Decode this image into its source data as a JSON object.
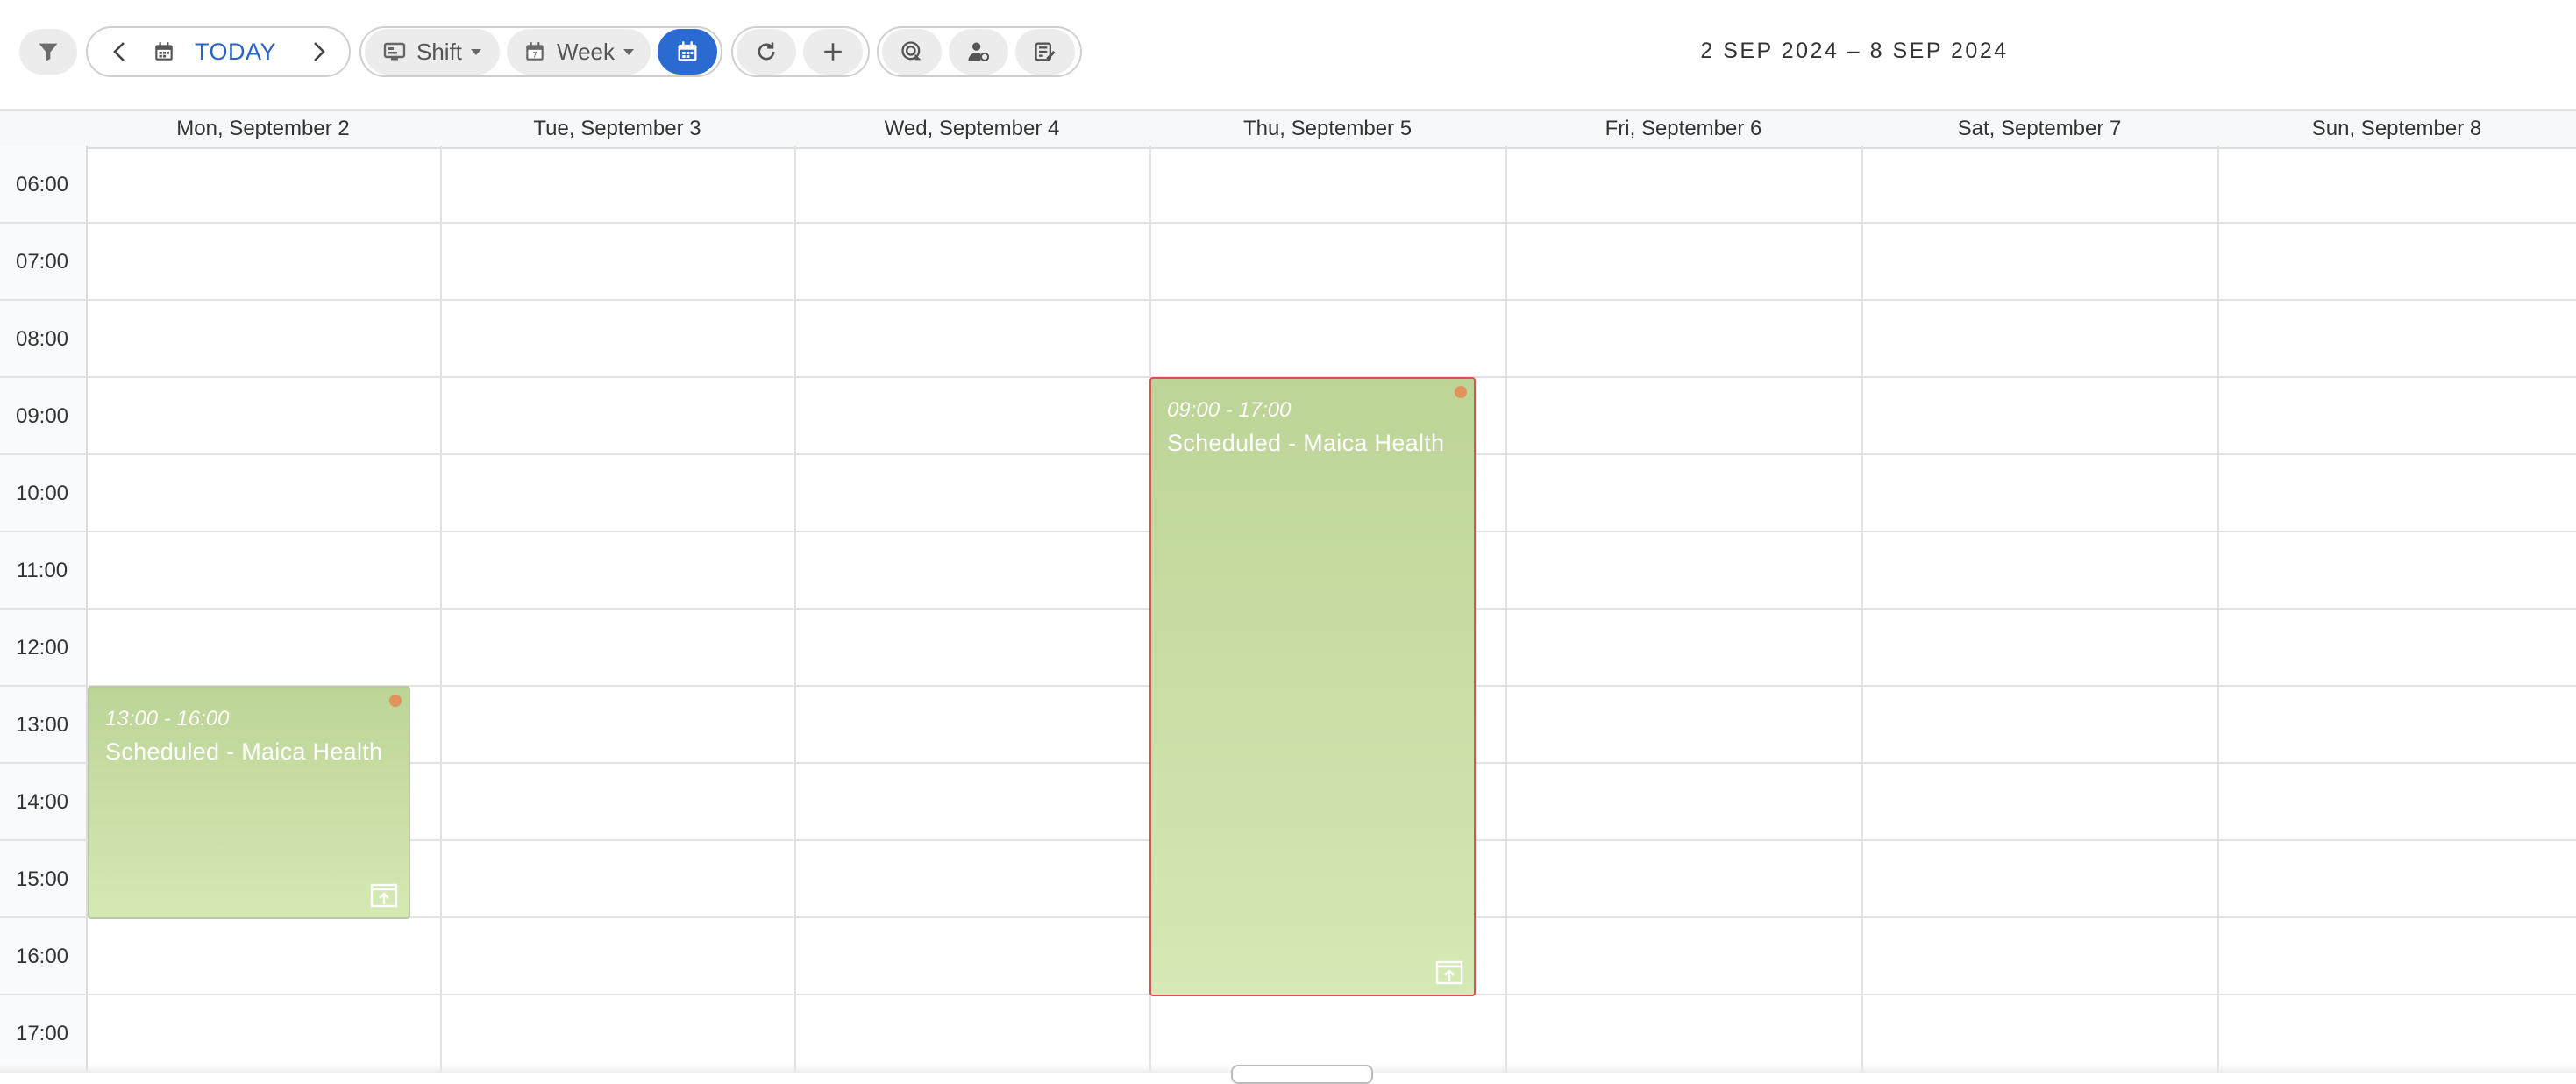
{
  "toolbar": {
    "today_label": "TODAY",
    "shift_label": "Shift",
    "week_label": "Week",
    "date_range": "2 SEP 2024 – 8 SEP 2024",
    "icons": {
      "filter": "filter-icon",
      "prev": "chevron-left-icon",
      "calendar": "calendar-icon",
      "next": "chevron-right-icon",
      "shift": "shift-view-icon",
      "week": "week-calendar-icon",
      "calendar_picker": "calendar-picker-icon",
      "refresh": "refresh-icon",
      "add": "plus-icon",
      "location": "location-icon",
      "user": "user-settings-icon",
      "notes": "notes-edit-icon"
    },
    "active_color": "#2a6bd1"
  },
  "calendar": {
    "days": [
      "Mon, September 2",
      "Tue, September 3",
      "Wed, September 4",
      "Thu, September 5",
      "Fri, September 6",
      "Sat, September 7",
      "Sun, September 8"
    ],
    "hours": [
      "06:00",
      "07:00",
      "08:00",
      "09:00",
      "10:00",
      "11:00",
      "12:00",
      "13:00",
      "14:00",
      "15:00",
      "16:00",
      "17:00"
    ],
    "events": [
      {
        "day": "Mon, September 2",
        "time": "13:00 - 16:00",
        "title": "Scheduled - Maica Health",
        "selected": false
      },
      {
        "day": "Thu, September 5",
        "time": "09:00 - 17:00",
        "title": "Scheduled - Maica Health",
        "selected": true
      }
    ],
    "event_color": "#c8dea5",
    "selected_border_color": "#d55454",
    "status_dot_color": "#e0935a"
  }
}
